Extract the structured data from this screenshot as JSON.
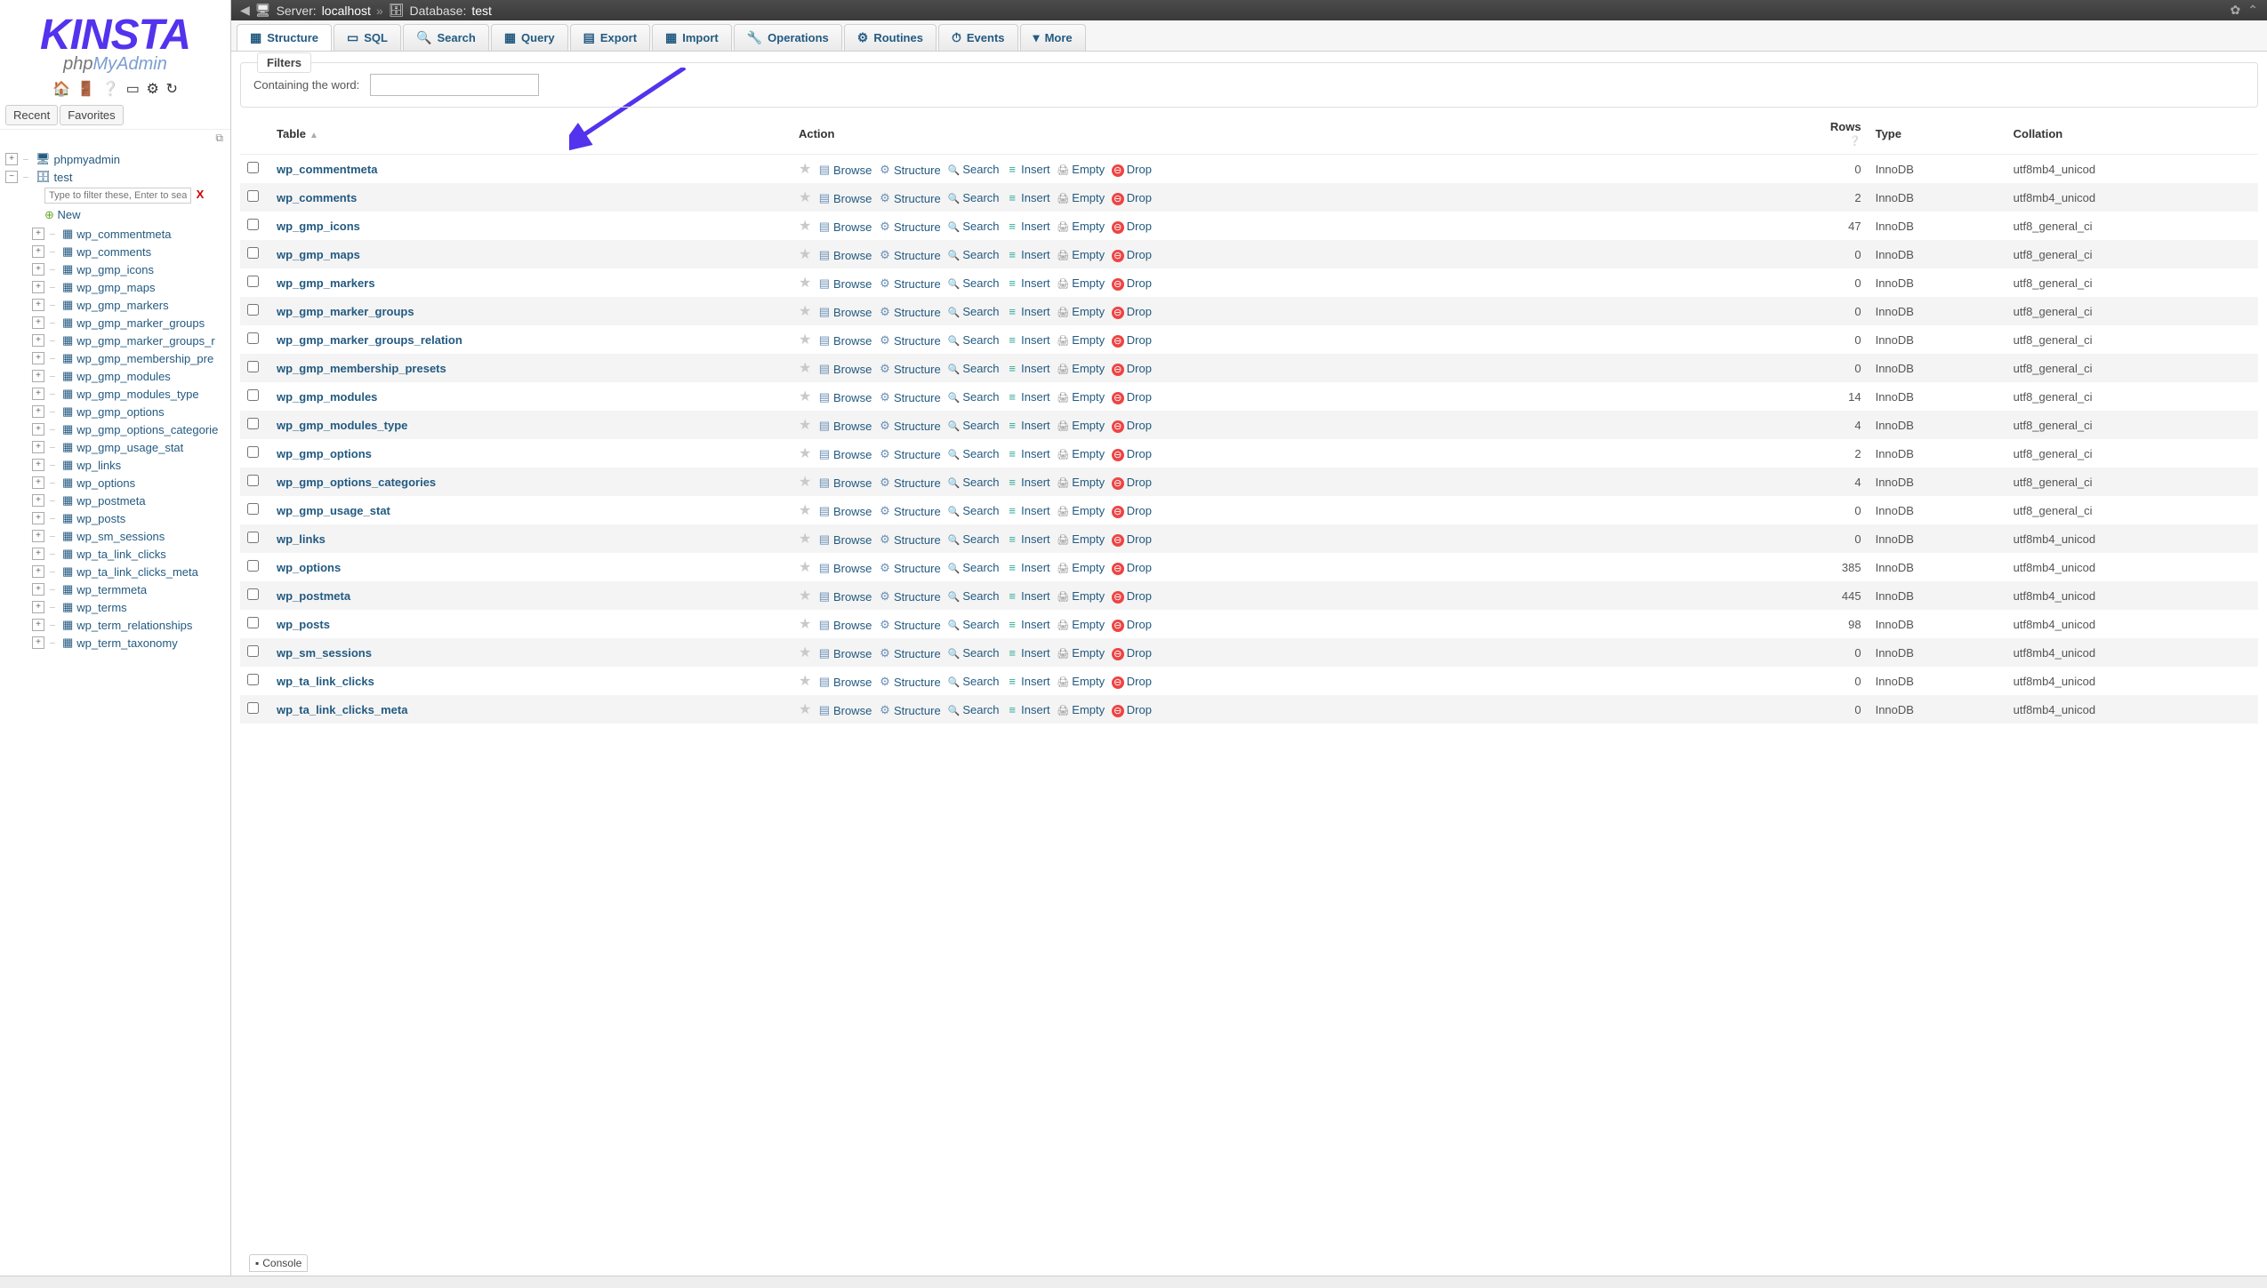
{
  "logo": {
    "phpmyadmin_prefix": "php",
    "phpmyadmin_suffix": "MyAdmin"
  },
  "recent_label": "Recent",
  "favorites_label": "Favorites",
  "sidebar_filter_placeholder": "Type to filter these, Enter to search",
  "sidebar_filter_clear": "X",
  "new_label": "New",
  "tree": {
    "root": "phpmyadmin",
    "db": "test",
    "tables": [
      "wp_commentmeta",
      "wp_comments",
      "wp_gmp_icons",
      "wp_gmp_maps",
      "wp_gmp_markers",
      "wp_gmp_marker_groups",
      "wp_gmp_marker_groups_r",
      "wp_gmp_membership_pre",
      "wp_gmp_modules",
      "wp_gmp_modules_type",
      "wp_gmp_options",
      "wp_gmp_options_categorie",
      "wp_gmp_usage_stat",
      "wp_links",
      "wp_options",
      "wp_postmeta",
      "wp_posts",
      "wp_sm_sessions",
      "wp_ta_link_clicks",
      "wp_ta_link_clicks_meta",
      "wp_termmeta",
      "wp_terms",
      "wp_term_relationships",
      "wp_term_taxonomy"
    ]
  },
  "breadcrumb": {
    "server_prefix": "Server:",
    "server": "localhost",
    "db_prefix": "Database:",
    "db": "test"
  },
  "tabs": [
    "Structure",
    "SQL",
    "Search",
    "Query",
    "Export",
    "Import",
    "Operations",
    "Routines",
    "Events",
    "More"
  ],
  "tab_icons": [
    "▦",
    "▭",
    "🔍",
    "▦",
    "▤",
    "▦",
    "🔧",
    "⚙",
    "⏱",
    "▾"
  ],
  "filters_legend": "Filters",
  "filters_label": "Containing the word:",
  "headers": {
    "table": "Table",
    "action": "Action",
    "rows": "Rows",
    "type": "Type",
    "collation": "Collation"
  },
  "actions": {
    "browse": "Browse",
    "structure": "Structure",
    "search": "Search",
    "insert": "Insert",
    "empty": "Empty",
    "drop": "Drop"
  },
  "rows": [
    {
      "name": "wp_commentmeta",
      "rows": "0",
      "type": "InnoDB",
      "coll": "utf8mb4_unicod"
    },
    {
      "name": "wp_comments",
      "rows": "2",
      "type": "InnoDB",
      "coll": "utf8mb4_unicod"
    },
    {
      "name": "wp_gmp_icons",
      "rows": "47",
      "type": "InnoDB",
      "coll": "utf8_general_ci"
    },
    {
      "name": "wp_gmp_maps",
      "rows": "0",
      "type": "InnoDB",
      "coll": "utf8_general_ci"
    },
    {
      "name": "wp_gmp_markers",
      "rows": "0",
      "type": "InnoDB",
      "coll": "utf8_general_ci"
    },
    {
      "name": "wp_gmp_marker_groups",
      "rows": "0",
      "type": "InnoDB",
      "coll": "utf8_general_ci"
    },
    {
      "name": "wp_gmp_marker_groups_relation",
      "rows": "0",
      "type": "InnoDB",
      "coll": "utf8_general_ci"
    },
    {
      "name": "wp_gmp_membership_presets",
      "rows": "0",
      "type": "InnoDB",
      "coll": "utf8_general_ci"
    },
    {
      "name": "wp_gmp_modules",
      "rows": "14",
      "type": "InnoDB",
      "coll": "utf8_general_ci"
    },
    {
      "name": "wp_gmp_modules_type",
      "rows": "4",
      "type": "InnoDB",
      "coll": "utf8_general_ci"
    },
    {
      "name": "wp_gmp_options",
      "rows": "2",
      "type": "InnoDB",
      "coll": "utf8_general_ci"
    },
    {
      "name": "wp_gmp_options_categories",
      "rows": "4",
      "type": "InnoDB",
      "coll": "utf8_general_ci"
    },
    {
      "name": "wp_gmp_usage_stat",
      "rows": "0",
      "type": "InnoDB",
      "coll": "utf8_general_ci"
    },
    {
      "name": "wp_links",
      "rows": "0",
      "type": "InnoDB",
      "coll": "utf8mb4_unicod"
    },
    {
      "name": "wp_options",
      "rows": "385",
      "type": "InnoDB",
      "coll": "utf8mb4_unicod"
    },
    {
      "name": "wp_postmeta",
      "rows": "445",
      "type": "InnoDB",
      "coll": "utf8mb4_unicod"
    },
    {
      "name": "wp_posts",
      "rows": "98",
      "type": "InnoDB",
      "coll": "utf8mb4_unicod"
    },
    {
      "name": "wp_sm_sessions",
      "rows": "0",
      "type": "InnoDB",
      "coll": "utf8mb4_unicod"
    },
    {
      "name": "wp_ta_link_clicks",
      "rows": "0",
      "type": "InnoDB",
      "coll": "utf8mb4_unicod"
    },
    {
      "name": "wp_ta_link_clicks_meta",
      "rows": "0",
      "type": "InnoDB",
      "coll": "utf8mb4_unicod"
    }
  ],
  "console_label": "Console"
}
